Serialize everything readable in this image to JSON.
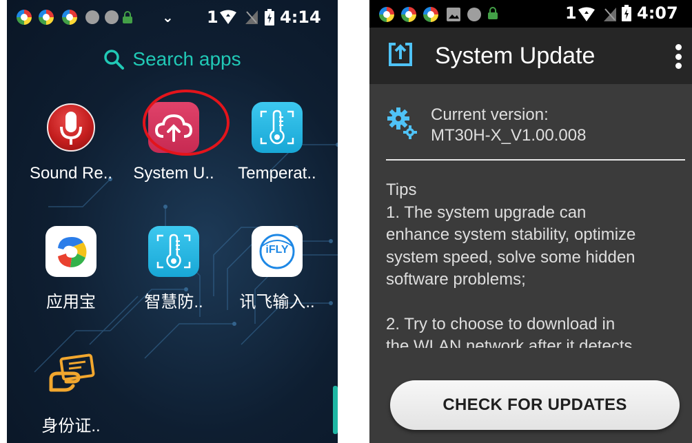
{
  "left": {
    "status": {
      "sim": "1",
      "time": "4:14"
    },
    "search": {
      "label": "Search apps",
      "icon": "search-icon",
      "color": "#21c9b6"
    },
    "apps": [
      {
        "id": "sound-recorder",
        "label": "Sound Re..",
        "icon": "microphone-icon"
      },
      {
        "id": "system-update",
        "label": "System U..",
        "icon": "cloud-upload-icon"
      },
      {
        "id": "temperature",
        "label": "Temperat..",
        "icon": "thermometer-icon"
      },
      {
        "id": "yingyongbao",
        "label": "应用宝",
        "icon": "app-store-icon"
      },
      {
        "id": "smart-prevention",
        "label": "智慧防..",
        "icon": "thermometer-icon"
      },
      {
        "id": "ifly-input",
        "label": "讯飞输入..",
        "icon": "ifly-icon",
        "logo_text": "iFLY"
      },
      {
        "id": "id-card",
        "label": "身份证..",
        "icon": "id-card-icon"
      }
    ],
    "highlight_color": "#e3141b"
  },
  "right": {
    "status": {
      "sim": "1",
      "time": "4:07"
    },
    "toolbar": {
      "title": "System Update",
      "icon": "system-update-icon"
    },
    "version": {
      "label": "Current version:",
      "value": "MT30H-X_V1.00.008",
      "icon": "gear-icon"
    },
    "tips": {
      "heading": "Tips",
      "line1": "1. The system upgrade can",
      "line2": "enhance system stability, optimize",
      "line3": "system speed, solve some hidden",
      "line4": "software problems;",
      "line5": " 2. Try to choose to download in",
      "line6": "the WLAN network after it detects"
    },
    "button": {
      "label": "CHECK FOR UPDATES"
    }
  }
}
